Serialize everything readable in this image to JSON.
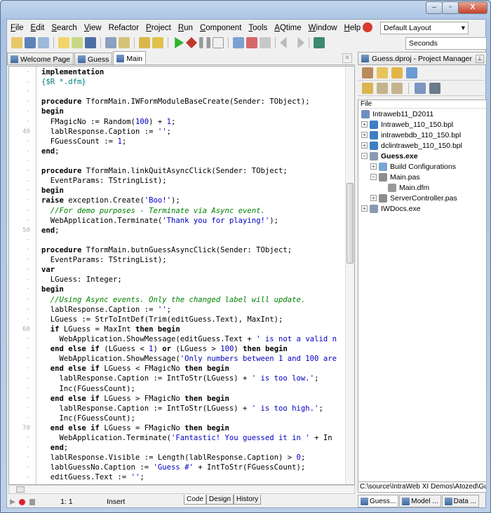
{
  "window": {
    "controls": [
      "minimize",
      "maximize",
      "close"
    ]
  },
  "menu": [
    {
      "label": "File",
      "u": "F",
      "rest": "ile"
    },
    {
      "label": "Edit",
      "u": "E",
      "rest": "dit"
    },
    {
      "label": "Search",
      "u": "S",
      "rest": "earch"
    },
    {
      "label": "View",
      "u": "V",
      "rest": "iew"
    },
    {
      "label": "Refactor",
      "u": "",
      "rest": "Refactor"
    },
    {
      "label": "Project",
      "u": "P",
      "rest": "roject"
    },
    {
      "label": "Run",
      "u": "R",
      "rest": "un"
    },
    {
      "label": "Component",
      "u": "C",
      "rest": "omponent"
    },
    {
      "label": "Tools",
      "u": "T",
      "rest": "ools"
    },
    {
      "label": "AQtime",
      "u": "A",
      "rest": "Qtime"
    },
    {
      "label": "Window",
      "u": "W",
      "rest": "indow"
    },
    {
      "label": "Help",
      "u": "H",
      "rest": "elp"
    }
  ],
  "layout_combo": "Default Layout",
  "seconds_combo": "Seconds",
  "tabs": [
    {
      "label": "Welcome Page",
      "active": false
    },
    {
      "label": "Guess",
      "active": false
    },
    {
      "label": "Main",
      "active": true
    }
  ],
  "code": {
    "first_line": 34,
    "lines": [
      [
        [
          "k",
          "implementation"
        ]
      ],
      [
        [
          "dir",
          "{$R *.dfm}"
        ]
      ],
      [],
      [
        [
          "k",
          "procedure"
        ],
        [
          "p",
          " TformMain.IWFormModuleBaseCreate(Sender: TObject);"
        ]
      ],
      [
        [
          "k",
          "begin"
        ]
      ],
      [
        [
          "p",
          "  FMagicNo := Random("
        ],
        [
          "num",
          "100"
        ],
        [
          "p",
          ") + "
        ],
        [
          "num",
          "1"
        ],
        [
          "p",
          ";"
        ]
      ],
      [
        [
          "p",
          "  lablResponse.Caption := "
        ],
        [
          "str",
          "''"
        ],
        [
          "p",
          ";"
        ]
      ],
      [
        [
          "p",
          "  FGuessCount := "
        ],
        [
          "num",
          "1"
        ],
        [
          "p",
          ";"
        ]
      ],
      [
        [
          "k",
          "end"
        ],
        [
          "p",
          ";"
        ]
      ],
      [],
      [
        [
          "k",
          "procedure"
        ],
        [
          "p",
          " TformMain.linkQuitAsyncClick(Sender: TObject;"
        ]
      ],
      [
        [
          "p",
          "  EventParams: TStringList);"
        ]
      ],
      [
        [
          "k",
          "begin"
        ]
      ],
      [
        [
          "k",
          "raise"
        ],
        [
          "p",
          " exception.Create("
        ],
        [
          "str",
          "'Boo!'"
        ],
        [
          "p",
          ");"
        ]
      ],
      [
        [
          "cmt",
          "  //For demo purposes - Terminate via Async event."
        ]
      ],
      [
        [
          "p",
          "  WebApplication.Terminate("
        ],
        [
          "str",
          "'Thank you for playing!'"
        ],
        [
          "p",
          ");"
        ]
      ],
      [
        [
          "k",
          "end"
        ],
        [
          "p",
          ";"
        ]
      ],
      [],
      [
        [
          "k",
          "procedure"
        ],
        [
          "p",
          " TformMain.butnGuessAsyncClick(Sender: TObject;"
        ]
      ],
      [
        [
          "p",
          "  EventParams: TStringList);"
        ]
      ],
      [
        [
          "k",
          "var"
        ]
      ],
      [
        [
          "p",
          "  LGuess: Integer;"
        ]
      ],
      [
        [
          "k",
          "begin"
        ]
      ],
      [
        [
          "cmt",
          "  //Using Async events. Only the changed label will update."
        ]
      ],
      [
        [
          "p",
          "  lablResponse.Caption := "
        ],
        [
          "str",
          "''"
        ],
        [
          "p",
          ";"
        ]
      ],
      [
        [
          "p",
          "  LGuess := StrToIntDef(Trim(editGuess.Text), MaxInt);"
        ]
      ],
      [
        [
          "p",
          "  "
        ],
        [
          "k",
          "if"
        ],
        [
          "p",
          " LGuess = MaxInt "
        ],
        [
          "k",
          "then begin"
        ]
      ],
      [
        [
          "p",
          "    WebApplication.ShowMessage(editGuess.Text + "
        ],
        [
          "str",
          "' is not a valid n"
        ]
      ],
      [
        [
          "p",
          "  "
        ],
        [
          "k",
          "end else if"
        ],
        [
          "p",
          " (LGuess < "
        ],
        [
          "num",
          "1"
        ],
        [
          "p",
          ") "
        ],
        [
          "k",
          "or"
        ],
        [
          "p",
          " (LGuess > "
        ],
        [
          "num",
          "100"
        ],
        [
          "p",
          ") "
        ],
        [
          "k",
          "then begin"
        ]
      ],
      [
        [
          "p",
          "    WebApplication.ShowMessage("
        ],
        [
          "str",
          "'Only numbers between 1 and 100 are"
        ]
      ],
      [
        [
          "p",
          "  "
        ],
        [
          "k",
          "end else if"
        ],
        [
          "p",
          " LGuess < FMagicNo "
        ],
        [
          "k",
          "then begin"
        ]
      ],
      [
        [
          "p",
          "    lablResponse.Caption := IntToStr(LGuess) + "
        ],
        [
          "str",
          "' is too low.'"
        ],
        [
          "p",
          ";"
        ]
      ],
      [
        [
          "p",
          "    Inc(FGuessCount);"
        ]
      ],
      [
        [
          "p",
          "  "
        ],
        [
          "k",
          "end else if"
        ],
        [
          "p",
          " LGuess > FMagicNo "
        ],
        [
          "k",
          "then begin"
        ]
      ],
      [
        [
          "p",
          "    lablResponse.Caption := IntToStr(LGuess) + "
        ],
        [
          "str",
          "' is too high.'"
        ],
        [
          "p",
          ";"
        ]
      ],
      [
        [
          "p",
          "    Inc(FGuessCount);"
        ]
      ],
      [
        [
          "p",
          "  "
        ],
        [
          "k",
          "end else if"
        ],
        [
          "p",
          " LGuess = FMagicNo "
        ],
        [
          "k",
          "then begin"
        ]
      ],
      [
        [
          "p",
          "    WebApplication.Terminate("
        ],
        [
          "str",
          "'Fantastic! You guessed it in '"
        ],
        [
          "p",
          " + In"
        ]
      ],
      [
        [
          "p",
          "  "
        ],
        [
          "k",
          "end"
        ],
        [
          "p",
          ";"
        ]
      ],
      [
        [
          "p",
          "  lablResponse.Visible := Length(lablResponse.Caption) > "
        ],
        [
          "num",
          "0"
        ],
        [
          "p",
          ";"
        ]
      ],
      [
        [
          "p",
          "  lablGuessNo.Caption := "
        ],
        [
          "str",
          "'Guess #'"
        ],
        [
          "p",
          " + IntToStr(FGuessCount);"
        ]
      ],
      [
        [
          "p",
          "  editGuess.Text := "
        ],
        [
          "str",
          "''"
        ],
        [
          "p",
          ";"
        ]
      ]
    ]
  },
  "status": {
    "position": "1: 1",
    "mode": "Insert",
    "tabs": [
      "Code",
      "Design",
      "History"
    ]
  },
  "project_manager": {
    "title": "Guess.dproj - Project Manager",
    "column": "File",
    "tree": [
      {
        "label": "Intraweb11_D2011",
        "level": 0,
        "exp": "",
        "bold": false,
        "icon": "project-group"
      },
      {
        "label": "Intraweb_110_150.bpl",
        "level": 0,
        "exp": "+",
        "bold": false,
        "icon": "package"
      },
      {
        "label": "intrawebdb_110_150.bpl",
        "level": 0,
        "exp": "+",
        "bold": false,
        "icon": "package"
      },
      {
        "label": "dclintraweb_110_150.bpl",
        "level": 0,
        "exp": "+",
        "bold": false,
        "icon": "package"
      },
      {
        "label": "Guess.exe",
        "level": 0,
        "exp": "-",
        "bold": true,
        "icon": "exe"
      },
      {
        "label": "Build Configurations",
        "level": 1,
        "exp": "+",
        "bold": false,
        "icon": "build-config"
      },
      {
        "label": "Main.pas",
        "level": 1,
        "exp": "-",
        "bold": false,
        "icon": "unit"
      },
      {
        "label": "Main.dfm",
        "level": 2,
        "exp": "",
        "bold": false,
        "icon": "form"
      },
      {
        "label": "ServerController.pas",
        "level": 1,
        "exp": "+",
        "bold": false,
        "icon": "unit"
      },
      {
        "label": "IWDocs.exe",
        "level": 0,
        "exp": "+",
        "bold": false,
        "icon": "exe"
      }
    ],
    "path": "C:\\source\\IntraWeb XI Demos\\Atozed\\Guess\\",
    "bottom_tabs": [
      "Guess...",
      "Model ...",
      "Data ..."
    ]
  }
}
